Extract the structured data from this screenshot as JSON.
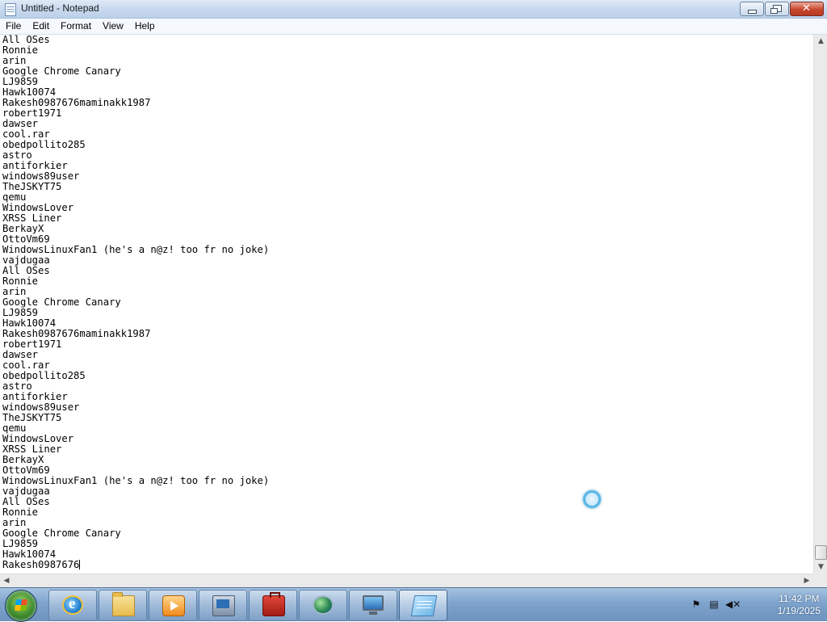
{
  "window": {
    "title": "Untitled - Notepad"
  },
  "menu": [
    "File",
    "Edit",
    "Format",
    "View",
    "Help"
  ],
  "editor": {
    "lines": [
      "All OSes",
      "Ronnie",
      "arin",
      "Google Chrome Canary",
      "LJ9859",
      "Hawk10074",
      "Rakesh0987676maminakk1987",
      "robert1971",
      "dawser",
      "cool.rar",
      "obedpollito285",
      "astro",
      "antiforkier",
      "windows89user",
      "TheJSKYT75",
      "qemu",
      "WindowsLover",
      "XRSS Liner",
      "BerkayX",
      "OttoVm69",
      "WindowsLinuxFan1 (he's a n@z! too fr no joke)",
      "vajdugaa",
      "All OSes",
      "Ronnie",
      "arin",
      "Google Chrome Canary",
      "LJ9859",
      "Hawk10074",
      "Rakesh0987676maminakk1987",
      "robert1971",
      "dawser",
      "cool.rar",
      "obedpollito285",
      "astro",
      "antiforkier",
      "windows89user",
      "TheJSKYT75",
      "qemu",
      "WindowsLover",
      "XRSS Liner",
      "BerkayX",
      "OttoVm69",
      "WindowsLinuxFan1 (he's a n@z! too fr no joke)",
      "vajdugaa",
      "All OSes",
      "Ronnie",
      "arin",
      "Google Chrome Canary",
      "LJ9859",
      "Hawk10074"
    ],
    "current_line": "Rakesh0987676"
  },
  "taskbar": {
    "buttons": [
      {
        "icon": "internet-explorer-icon"
      },
      {
        "icon": "file-explorer-icon"
      },
      {
        "icon": "media-player-icon"
      },
      {
        "icon": "network-icon"
      },
      {
        "icon": "toolbox-icon"
      },
      {
        "icon": "globe-icon"
      },
      {
        "icon": "remote-desktop-icon"
      },
      {
        "icon": "notepad-icon",
        "active": true
      }
    ],
    "clock": {
      "time": "11:42 PM",
      "date": "1/19/2025"
    }
  },
  "colors": {
    "taskbar": "#7ea3cc",
    "titlebar": "#c8d9ee",
    "close_button": "#c8462c"
  }
}
